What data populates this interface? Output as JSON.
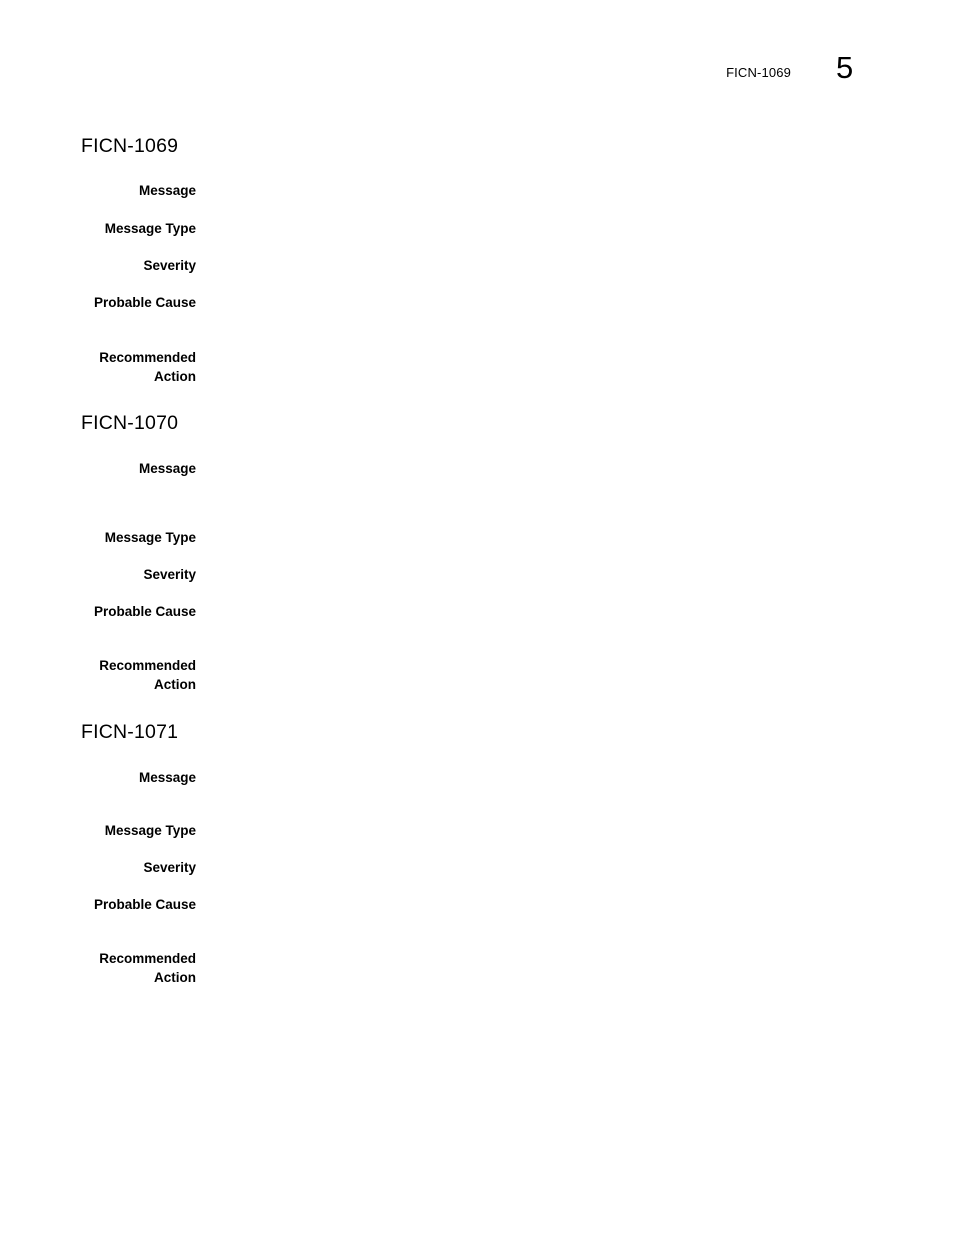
{
  "document": {
    "page_number": "5",
    "running_header": "FICN-1069"
  },
  "labels": {
    "message": "Message",
    "message_type": "Message Type",
    "severity": "Severity",
    "probable_cause": "Probable Cause",
    "recommended_action": "Recommended\nAction"
  },
  "sections": [
    {
      "title": "FICN-1069",
      "fields": {
        "message": "",
        "message_type": "",
        "severity": "",
        "probable_cause": "",
        "recommended_action": ""
      }
    },
    {
      "title": "FICN-1070",
      "fields": {
        "message": "",
        "message_type": "",
        "severity": "",
        "probable_cause": "",
        "recommended_action": ""
      }
    },
    {
      "title": "FICN-1071",
      "fields": {
        "message": "",
        "message_type": "",
        "severity": "",
        "probable_cause": "",
        "recommended_action": ""
      }
    }
  ]
}
